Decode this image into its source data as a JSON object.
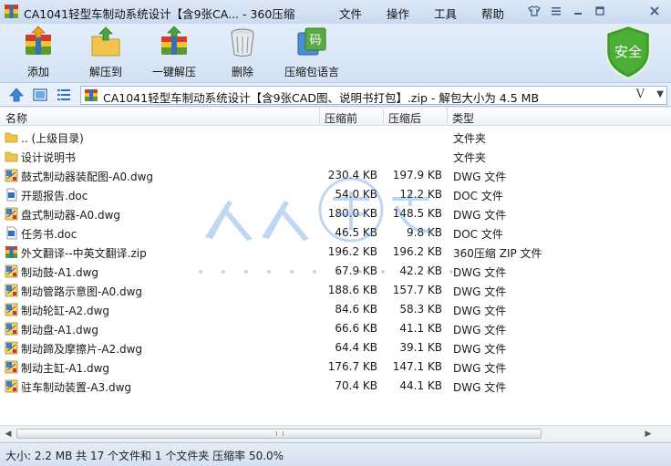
{
  "window": {
    "title": "CA1041轻型车制动系统设计【含9张CA... - 360压缩",
    "menus": [
      "文件",
      "操作",
      "工具",
      "帮助"
    ],
    "controls": {
      "skin": "skin-icon",
      "menu": "menu-icon",
      "minimize": "minimize-icon",
      "maximize": "maximize-icon",
      "close": "close-icon"
    }
  },
  "toolbar": {
    "add_label": "添加",
    "extract_label": "解压到",
    "oneclick_label": "一键解压",
    "delete_label": "删除",
    "lang_label": "压缩包语言",
    "lang_icon_text": "码",
    "safe_label": "安全"
  },
  "address": {
    "path": "CA1041轻型车制动系统设计【含9张CAD图、说明书打包】.zip - 解包大小为 4.5 MB",
    "v_glyph": "V"
  },
  "columns": {
    "name": "名称",
    "size": "压缩前",
    "packed": "压缩后",
    "type": "类型"
  },
  "files": [
    {
      "name": ".. (上级目录)",
      "size": "",
      "packed": "",
      "type": "文件夹",
      "icon": "folder-up"
    },
    {
      "name": "设计说明书",
      "size": "",
      "packed": "",
      "type": "文件夹",
      "icon": "folder"
    },
    {
      "name": "鼓式制动器装配图-A0.dwg",
      "size": "230.4 KB",
      "packed": "197.9 KB",
      "type": "DWG 文件",
      "icon": "dwg"
    },
    {
      "name": "开题报告.doc",
      "size": "54.0 KB",
      "packed": "12.2 KB",
      "type": "DOC 文件",
      "icon": "doc"
    },
    {
      "name": "盘式制动器-A0.dwg",
      "size": "180.0 KB",
      "packed": "148.5 KB",
      "type": "DWG 文件",
      "icon": "dwg"
    },
    {
      "name": "任务书.doc",
      "size": "46.5 KB",
      "packed": "9.8 KB",
      "type": "DOC 文件",
      "icon": "doc"
    },
    {
      "name": "外文翻译--中英文翻译.zip",
      "size": "196.2 KB",
      "packed": "196.2 KB",
      "type": "360压缩 ZIP 文件",
      "icon": "zip"
    },
    {
      "name": "制动鼓-A1.dwg",
      "size": "67.9 KB",
      "packed": "42.2 KB",
      "type": "DWG 文件",
      "icon": "dwg"
    },
    {
      "name": "制动管路示意图-A0.dwg",
      "size": "188.6 KB",
      "packed": "157.7 KB",
      "type": "DWG 文件",
      "icon": "dwg"
    },
    {
      "name": "制动轮缸-A2.dwg",
      "size": "84.6 KB",
      "packed": "58.3 KB",
      "type": "DWG 文件",
      "icon": "dwg"
    },
    {
      "name": "制动盘-A1.dwg",
      "size": "66.6 KB",
      "packed": "41.1 KB",
      "type": "DWG 文件",
      "icon": "dwg"
    },
    {
      "name": "制动蹄及摩擦片-A2.dwg",
      "size": "64.4 KB",
      "packed": "39.1 KB",
      "type": "DWG 文件",
      "icon": "dwg"
    },
    {
      "name": "制动主缸-A1.dwg",
      "size": "176.7 KB",
      "packed": "147.1 KB",
      "type": "DWG 文件",
      "icon": "dwg"
    },
    {
      "name": "驻车制动装置-A3.dwg",
      "size": "70.4 KB",
      "packed": "44.1 KB",
      "type": "DWG 文件",
      "icon": "dwg"
    }
  ],
  "status": {
    "text": "大小: 2.2 MB 共 17 个文件和 1 个文件夹 压缩率 50.0%"
  },
  "colors": {
    "accent": "#3b78c4",
    "safe_green": "#3f9b2e",
    "folder_yellow": "#f0c44c"
  }
}
